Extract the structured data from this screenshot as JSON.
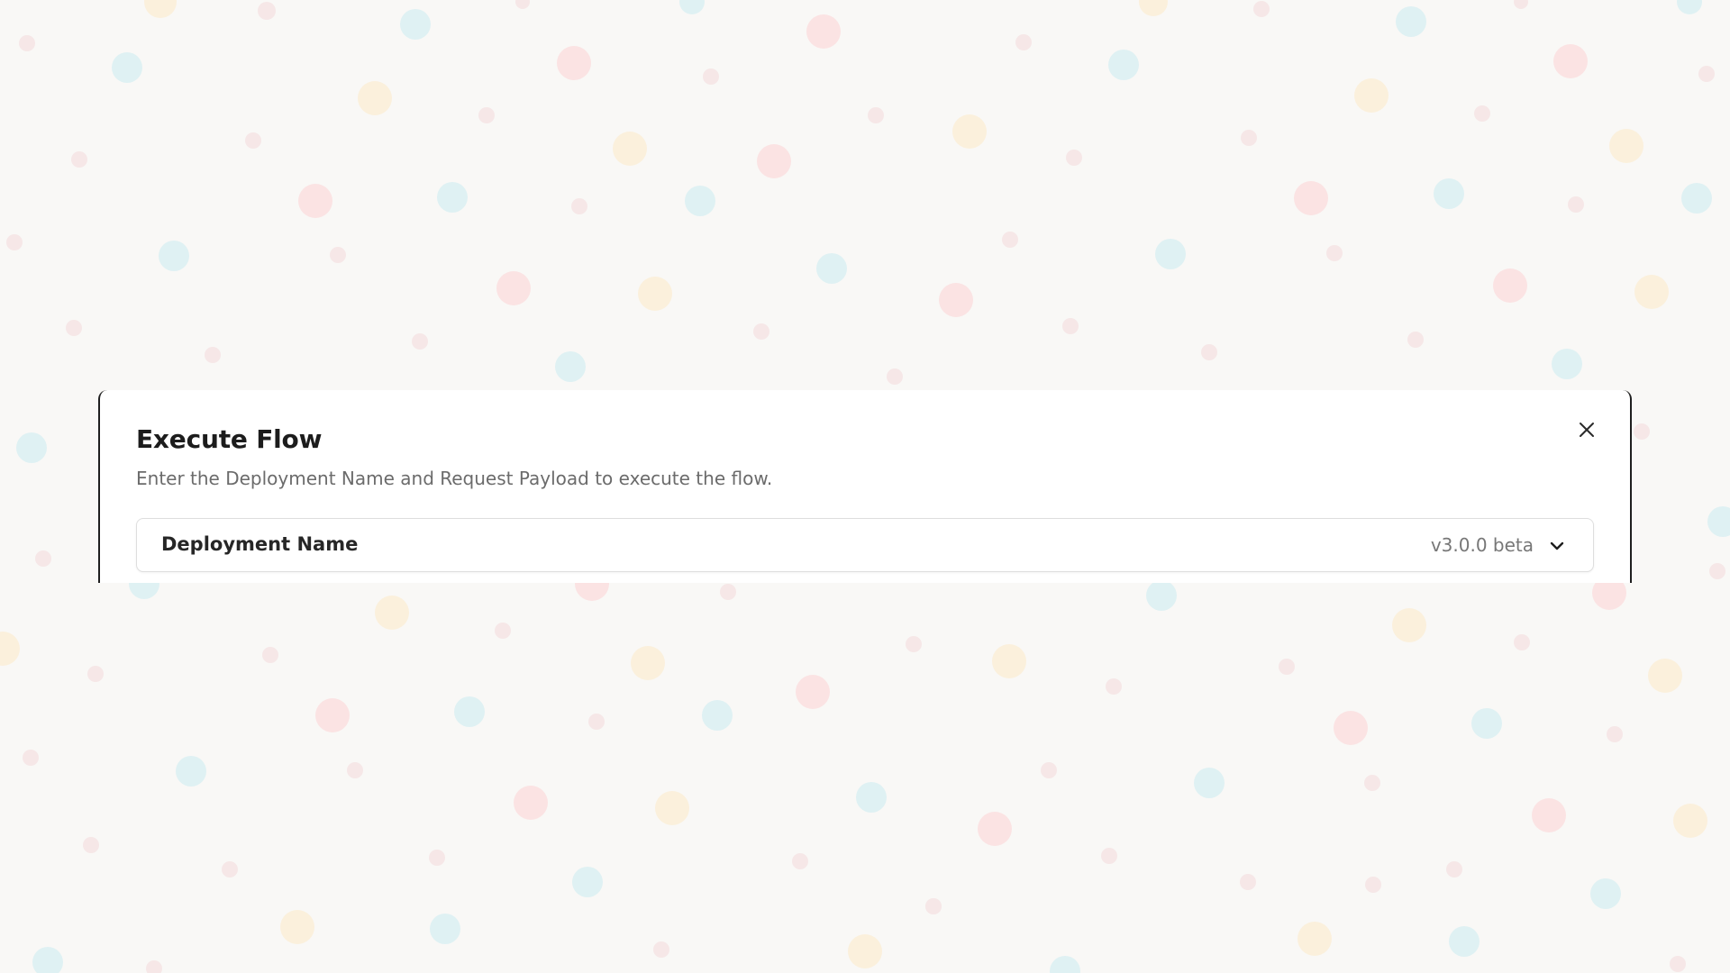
{
  "dialog": {
    "title": "Execute Flow",
    "subtitle": "Enter the Deployment Name and Request Payload to execute the flow.",
    "close_icon": "close-icon",
    "deployment_select": {
      "label": "Deployment Name",
      "version": "v3.0.0 beta",
      "icon": "chevron-down-icon"
    }
  },
  "colors": {
    "background": "#f9f8f6",
    "dialog_background": "#ffffff",
    "dialog_frame": "#1f1f1f",
    "title_text": "#1c1c1c",
    "subtitle_text": "#6b6b6b",
    "dot_pink": "#fbe3e3",
    "dot_cyan": "#dff1f3",
    "dot_yellow": "#fbf0dc"
  }
}
